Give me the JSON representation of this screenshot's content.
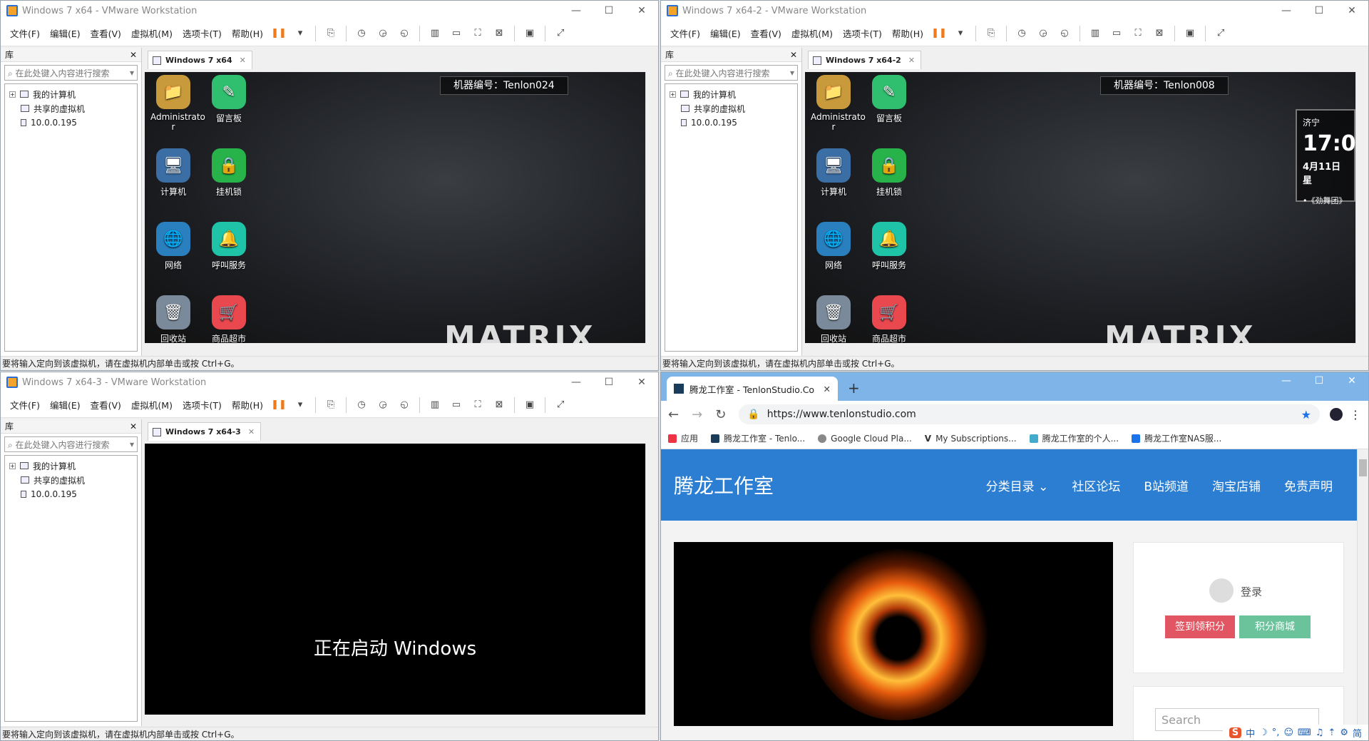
{
  "vm_common": {
    "menu": [
      "文件(F)",
      "编辑(E)",
      "查看(V)",
      "虚拟机(M)",
      "选项卡(T)",
      "帮助(H)"
    ],
    "library_title": "库",
    "search_placeholder": "在此处键入内容进行搜索",
    "tree": [
      "我的计算机",
      "共享的虚拟机",
      "10.0.0.195"
    ],
    "status_text": "要将输入定向到该虚拟机，请在虚拟机内部单击或按 Ctrl+G。",
    "close_glyph": "✕"
  },
  "vm1": {
    "title": "Windows 7 x64 - VMware Workstation",
    "tab": "Windows 7 x64",
    "machine_label": "机器编号：Tenlon024",
    "matrix": "MATRIX"
  },
  "vm2": {
    "title": "Windows 7 x64-2 - VMware Workstation",
    "tab": "Windows 7 x64-2",
    "machine_label": "机器编号：Tenlon008",
    "matrix": "MATRIX",
    "clock": {
      "city": "济宁",
      "time": "17:0",
      "date": "4月11日星",
      "item": "•《劲舞团》"
    }
  },
  "vm3": {
    "title": "Windows 7 x64-3 - VMware Workstation",
    "tab": "Windows 7 x64-3",
    "boot_text": "正在启动 Windows"
  },
  "desktop_icons": [
    {
      "label": "Administrato r",
      "icon": "user-folder-icon",
      "color": "#c99a3b",
      "glyph": "📁"
    },
    {
      "label": "留言板",
      "icon": "notepad-icon",
      "color": "#2fbf6e",
      "glyph": "✎"
    },
    {
      "label": "计算机",
      "icon": "computer-icon",
      "color": "#3a6ea5",
      "glyph": "🖥"
    },
    {
      "label": "挂机锁",
      "icon": "lock-icon",
      "color": "#27b24a",
      "glyph": "🔒"
    },
    {
      "label": "网络",
      "icon": "network-icon",
      "color": "#2a7fbf",
      "glyph": "🌐"
    },
    {
      "label": "呼叫服务",
      "icon": "bell-icon",
      "color": "#1fc4a8",
      "glyph": "🔔"
    },
    {
      "label": "回收站",
      "icon": "recycle-bin-icon",
      "color": "#7a8a9a",
      "glyph": "🗑"
    },
    {
      "label": "商品超市",
      "icon": "cart-icon",
      "color": "#e9484f",
      "glyph": "🛒"
    }
  ],
  "browser": {
    "tab_title": "腾龙工作室 - TenlonStudio.Co",
    "url": "https://www.tenlonstudio.com",
    "bookmarks": [
      {
        "label": "应用",
        "color": "#e34"
      },
      {
        "label": "腾龙工作室 - Tenlo...",
        "color": "#1a3d5c"
      },
      {
        "label": "Google Cloud Pla...",
        "color": "#888"
      },
      {
        "label": "My Subscriptions...",
        "color": "#fff"
      },
      {
        "label": "腾龙工作室的个人...",
        "color": "#4ac"
      },
      {
        "label": "腾龙工作室NAS服...",
        "color": "#1a73e8"
      }
    ],
    "site_title": "腾龙工作室",
    "nav": [
      "分类目录 ⌄",
      "社区论坛",
      "B站频道",
      "淘宝店铺",
      "免责声明"
    ],
    "login": "登录",
    "btn_checkin": "签到领积分",
    "btn_shop": "积分商城",
    "search_placeholder": "Search",
    "tray": [
      "S",
      "中",
      "☽",
      "°,",
      "☺",
      "⌨",
      "♫",
      "⇡",
      "⚙",
      "简"
    ],
    "colors": {
      "header": "#2b7ed1",
      "checkin": "#e25563",
      "shop": "#6bc39b"
    }
  }
}
